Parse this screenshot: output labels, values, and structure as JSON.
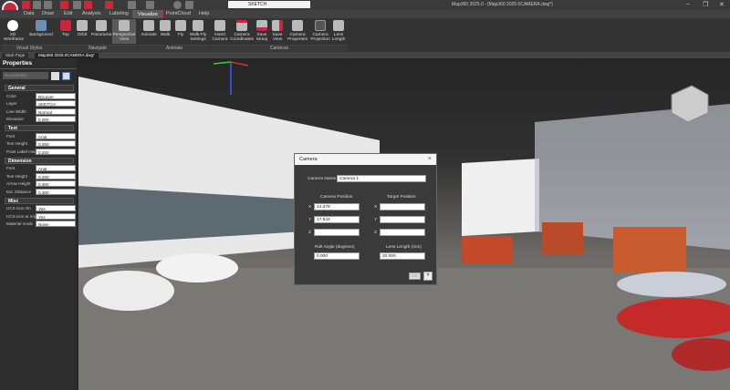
{
  "window": {
    "title": "Map360 2025.0 - [Map360 2025.0CAMERA.dwg*]",
    "minimize": "–",
    "restore": "❐",
    "close": "✕"
  },
  "layer_combo": "SKETCH",
  "tabs": [
    "Data",
    "Draw",
    "Edit",
    "Analysis",
    "Labeling",
    "Visualize",
    "PointCloud",
    "Help"
  ],
  "active_tab": "Visualize",
  "ribbon": {
    "buttons": [
      {
        "label": "2D Wireframe",
        "icon": "wireframe-icon"
      },
      {
        "label": "Background",
        "icon": "background-icon"
      },
      {
        "label": "Top",
        "icon": "top-view-icon"
      },
      {
        "label": "Orbit",
        "icon": "orbit-icon"
      },
      {
        "label": "Panorama",
        "icon": "panorama-icon"
      },
      {
        "label": "Perspective View",
        "icon": "perspective-icon"
      },
      {
        "label": "Animate",
        "icon": "animate-icon"
      },
      {
        "label": "Walk",
        "icon": "walk-icon"
      },
      {
        "label": "Fly",
        "icon": "fly-icon"
      },
      {
        "label": "Walk-Fly Settings",
        "icon": "walk-fly-settings-icon"
      },
      {
        "label": "Insert Camera",
        "icon": "camera-insert-icon"
      },
      {
        "label": "Camera Coordinates",
        "icon": "camera-xyz-icon"
      },
      {
        "label": "Save Setup",
        "icon": "camera-save-setup-icon"
      },
      {
        "label": "Save View",
        "icon": "camera-save-view-icon"
      },
      {
        "label": "Camera Properties",
        "icon": "camera-properties-icon"
      },
      {
        "label": "Camera Projection",
        "icon": "camera-projection-icon"
      },
      {
        "label": "Lens Length",
        "icon": "lens-length-icon"
      }
    ],
    "groups": [
      "Visual Styles",
      "Navigate",
      "Animate",
      "Cameras"
    ]
  },
  "doc_tabs": [
    "Start Page",
    "Map360 2025.0CAMERA.dwg*"
  ],
  "properties": {
    "title": "Properties",
    "selection_placeholder": "No selection",
    "sections": [
      {
        "name": "General",
        "rows": [
          [
            "Color",
            "ByLayer"
          ],
          [
            "Layer",
            "SKETCH"
          ],
          [
            "Line Width",
            "Normal"
          ],
          [
            "Elevation",
            "0.000"
          ]
        ]
      },
      {
        "name": "Text",
        "rows": [
          [
            "Font",
            "Arial"
          ],
          [
            "Text Height",
            "0.250"
          ],
          [
            "Point Label Height",
            "0.250"
          ]
        ]
      },
      {
        "name": "Dimension",
        "rows": [
          [
            "Font",
            "Arial"
          ],
          [
            "Text Height",
            "0.250"
          ],
          [
            "Arrow Height",
            "0.300"
          ],
          [
            "Ext. Distance",
            "0.300"
          ]
        ]
      },
      {
        "name": "Misc",
        "rows": [
          [
            "UCS icon On",
            "Yes"
          ],
          [
            "UCS icon at origin",
            "Yes"
          ],
          [
            "Material mode",
            "None"
          ]
        ]
      }
    ]
  },
  "dialog": {
    "title": "Camera",
    "camera_name_label": "Camera Name",
    "camera_name": "Camera 1",
    "camera_position_label": "Camera Position",
    "target_position_label": "Target Position",
    "x_label": "X",
    "y_label": "Y",
    "z_label": "Z",
    "camera_x": "14.378",
    "camera_y": "17.544",
    "camera_z": "",
    "target_x": "",
    "target_y": "",
    "target_z": "",
    "roll_label": "Roll Angle (degrees)",
    "roll": "0.000",
    "lens_label": "Lens Length (mm)",
    "lens": "20.000",
    "ok": "OK",
    "help": "?"
  }
}
